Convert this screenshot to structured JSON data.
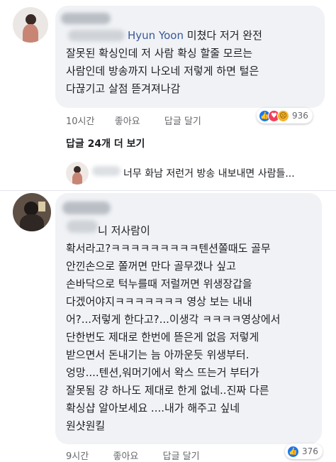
{
  "comment1": {
    "mention": "Hyun Yoon",
    "lines": [
      "미쳤다 저거 완전",
      "잘못된 확싱인데 저 사람 확싱 할줄 모르는",
      "사람인데 방송까지 나오네 저렇게 하면 털은",
      "다끊기고 살점 뜯겨져나감"
    ],
    "time": "10시간",
    "like_label": "좋아요",
    "reply_label": "답글 달기",
    "reaction_count": "936"
  },
  "more_replies": "답글 24개 더 보기",
  "reply_preview_text": "너무 화남 저런거 방송 내보내면 사람들...",
  "comment2": {
    "lines": [
      "니 저사람이",
      "확서라고?ㅋㅋㅋㅋㅋㅋㅋㅋㅋ텐션쫄때도 골무",
      "안낀손으로 쫄꺼면 만다 골무갰나 싶고",
      "손바닥으로 턱누를때 저럴꺼면 위생장갑을",
      "다겠어야지ㅋㅋㅋㅋㅋㅋㅋ 영상 보는 내내",
      "어?...저렇게 한다고?...이생각 ㅋㅋㅋㅋ영상에서",
      "단한번도 제대로 한번에 뜯은게 없음 저렇게",
      "받으면서 돈내기는 늠 아까운듯 위생부터.",
      "엉망....텐션,워머기에서 왁스 뜨는거 부터가",
      "잘못됨 걍 하나도 제대로 한게 없네..진짜 다른",
      "확싱샵 알아보세요 ....내가 해주고 싶네",
      "원샷원킬"
    ],
    "time": "9시간",
    "like_label": "좋아요",
    "reply_label": "답글 달기",
    "reaction_count": "376"
  },
  "colors": {
    "bubble": "#f0f2f5",
    "like_blue": "#1877f2",
    "love_red": "#f33e58",
    "sad_yellow": "#f7b125",
    "mention_link": "#385898"
  },
  "icons": [
    "like-icon",
    "love-icon",
    "sad-icon"
  ]
}
